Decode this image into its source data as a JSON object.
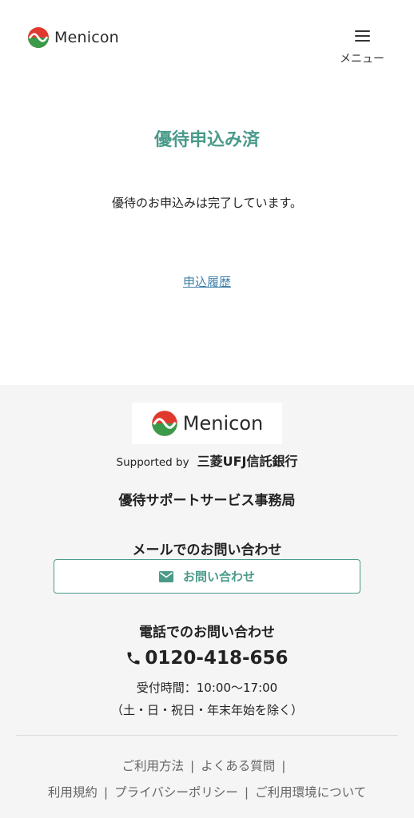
{
  "header": {
    "logo_text": "Menicon",
    "menu_label": "メニュー"
  },
  "main": {
    "title": "優待申込み済",
    "message": "優待のお申込みは完了しています。",
    "history_link": "申込履歴"
  },
  "footer": {
    "logo_text": "Menicon",
    "supported_by": "Supported by",
    "bank_name": "三菱UFJ信託銀行",
    "office_name": "優待サポートサービス事務局",
    "mail_heading": "メールでのお問い合わせ",
    "contact_button": "お問い合わせ",
    "tel_heading": "電話でのお問い合わせ",
    "tel_number": "0120-418-656",
    "hours": "受付時間：10:00〜17:00",
    "holidays": "（土・日・祝日・年末年始を除く）",
    "links_row1": [
      "ご利用方法",
      "よくある質問"
    ],
    "links_row2": [
      "利用規約",
      "プライバシーポリシー",
      "ご利用環境について"
    ],
    "copyright": ""
  },
  "colors": {
    "accent": "#4a9a8a",
    "link": "#3e7fa8",
    "footer_bg": "#f5f5f5",
    "logo_red": "#e03a2e",
    "logo_green": "#3a9a4a"
  }
}
